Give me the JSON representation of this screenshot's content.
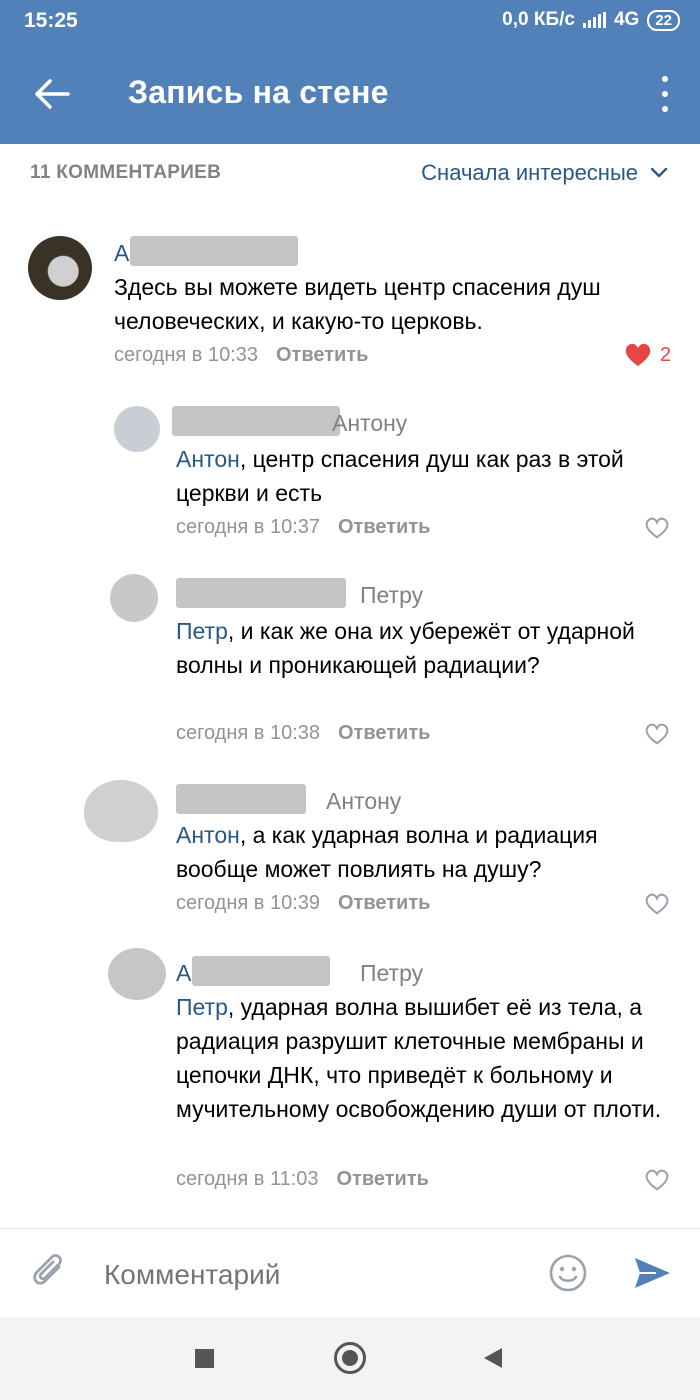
{
  "status_bar": {
    "time": "15:25",
    "network_speed": "0,0 КБ/с",
    "network_type": "4G",
    "battery": "22"
  },
  "app_bar": {
    "title": "Запись на стене",
    "back_icon": "arrow-left-icon",
    "more_icon": "more-vertical-icon"
  },
  "comments_header": {
    "count_label": "11 КОММЕНТАРИЕВ",
    "sort_label": "Сначала интересные"
  },
  "comments": [
    {
      "author_visible": "А",
      "reply_to": "",
      "mention": "",
      "text": "Здесь вы можете видеть центр спасения душ человеческих, и какую-то церковь.",
      "time": "сегодня в 10:33",
      "reply_label": "Ответить",
      "liked": true,
      "likes": "2"
    },
    {
      "author_visible": "",
      "reply_to": "Антону",
      "mention": "Антон",
      "text": ", центр спасения душ как раз в этой церкви и есть",
      "time": "сегодня в 10:37",
      "reply_label": "Ответить",
      "liked": false,
      "likes": ""
    },
    {
      "author_visible": "",
      "reply_to": "Петру",
      "mention": "Петр",
      "text": ", и как же она их убережёт от ударной волны и проникающей радиации?",
      "time": "сегодня в 10:38",
      "reply_label": "Ответить",
      "liked": false,
      "likes": ""
    },
    {
      "author_visible": "",
      "reply_to": "Антону",
      "mention": "Антон",
      "text": ", а как ударная волна и радиация вообще может повлиять на душу?",
      "time": "сегодня в 10:39",
      "reply_label": "Ответить",
      "liked": false,
      "likes": ""
    },
    {
      "author_visible": "А",
      "reply_to": "Петру",
      "mention": "Петр",
      "text": ", ударная волна вышибет её из тела, а радиация разрушит клеточные мембраны и цепочки ДНК, что приведёт к больному и мучительному освобождению души от плоти.",
      "time": "сегодня в 11:03",
      "reply_label": "Ответить",
      "liked": false,
      "likes": ""
    }
  ],
  "composer": {
    "placeholder": "Комментарий"
  },
  "colors": {
    "header": "#5181b8",
    "link": "#2a5885",
    "like": "#e64646",
    "meta": "#939393"
  }
}
